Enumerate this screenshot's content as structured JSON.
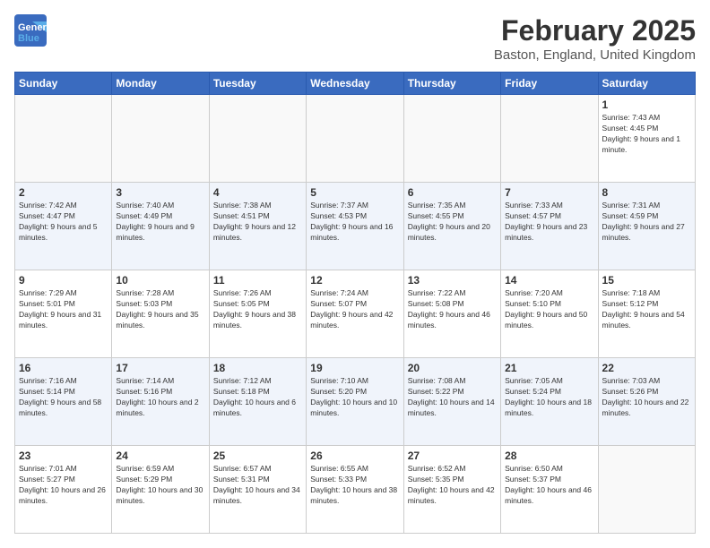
{
  "header": {
    "logo_line1": "General",
    "logo_line2": "Blue",
    "title": "February 2025",
    "location": "Baston, England, United Kingdom"
  },
  "weekdays": [
    "Sunday",
    "Monday",
    "Tuesday",
    "Wednesday",
    "Thursday",
    "Friday",
    "Saturday"
  ],
  "weeks": [
    [
      {
        "day": "",
        "info": ""
      },
      {
        "day": "",
        "info": ""
      },
      {
        "day": "",
        "info": ""
      },
      {
        "day": "",
        "info": ""
      },
      {
        "day": "",
        "info": ""
      },
      {
        "day": "",
        "info": ""
      },
      {
        "day": "1",
        "info": "Sunrise: 7:43 AM\nSunset: 4:45 PM\nDaylight: 9 hours and 1 minute."
      }
    ],
    [
      {
        "day": "2",
        "info": "Sunrise: 7:42 AM\nSunset: 4:47 PM\nDaylight: 9 hours and 5 minutes."
      },
      {
        "day": "3",
        "info": "Sunrise: 7:40 AM\nSunset: 4:49 PM\nDaylight: 9 hours and 9 minutes."
      },
      {
        "day": "4",
        "info": "Sunrise: 7:38 AM\nSunset: 4:51 PM\nDaylight: 9 hours and 12 minutes."
      },
      {
        "day": "5",
        "info": "Sunrise: 7:37 AM\nSunset: 4:53 PM\nDaylight: 9 hours and 16 minutes."
      },
      {
        "day": "6",
        "info": "Sunrise: 7:35 AM\nSunset: 4:55 PM\nDaylight: 9 hours and 20 minutes."
      },
      {
        "day": "7",
        "info": "Sunrise: 7:33 AM\nSunset: 4:57 PM\nDaylight: 9 hours and 23 minutes."
      },
      {
        "day": "8",
        "info": "Sunrise: 7:31 AM\nSunset: 4:59 PM\nDaylight: 9 hours and 27 minutes."
      }
    ],
    [
      {
        "day": "9",
        "info": "Sunrise: 7:29 AM\nSunset: 5:01 PM\nDaylight: 9 hours and 31 minutes."
      },
      {
        "day": "10",
        "info": "Sunrise: 7:28 AM\nSunset: 5:03 PM\nDaylight: 9 hours and 35 minutes."
      },
      {
        "day": "11",
        "info": "Sunrise: 7:26 AM\nSunset: 5:05 PM\nDaylight: 9 hours and 38 minutes."
      },
      {
        "day": "12",
        "info": "Sunrise: 7:24 AM\nSunset: 5:07 PM\nDaylight: 9 hours and 42 minutes."
      },
      {
        "day": "13",
        "info": "Sunrise: 7:22 AM\nSunset: 5:08 PM\nDaylight: 9 hours and 46 minutes."
      },
      {
        "day": "14",
        "info": "Sunrise: 7:20 AM\nSunset: 5:10 PM\nDaylight: 9 hours and 50 minutes."
      },
      {
        "day": "15",
        "info": "Sunrise: 7:18 AM\nSunset: 5:12 PM\nDaylight: 9 hours and 54 minutes."
      }
    ],
    [
      {
        "day": "16",
        "info": "Sunrise: 7:16 AM\nSunset: 5:14 PM\nDaylight: 9 hours and 58 minutes."
      },
      {
        "day": "17",
        "info": "Sunrise: 7:14 AM\nSunset: 5:16 PM\nDaylight: 10 hours and 2 minutes."
      },
      {
        "day": "18",
        "info": "Sunrise: 7:12 AM\nSunset: 5:18 PM\nDaylight: 10 hours and 6 minutes."
      },
      {
        "day": "19",
        "info": "Sunrise: 7:10 AM\nSunset: 5:20 PM\nDaylight: 10 hours and 10 minutes."
      },
      {
        "day": "20",
        "info": "Sunrise: 7:08 AM\nSunset: 5:22 PM\nDaylight: 10 hours and 14 minutes."
      },
      {
        "day": "21",
        "info": "Sunrise: 7:05 AM\nSunset: 5:24 PM\nDaylight: 10 hours and 18 minutes."
      },
      {
        "day": "22",
        "info": "Sunrise: 7:03 AM\nSunset: 5:26 PM\nDaylight: 10 hours and 22 minutes."
      }
    ],
    [
      {
        "day": "23",
        "info": "Sunrise: 7:01 AM\nSunset: 5:27 PM\nDaylight: 10 hours and 26 minutes."
      },
      {
        "day": "24",
        "info": "Sunrise: 6:59 AM\nSunset: 5:29 PM\nDaylight: 10 hours and 30 minutes."
      },
      {
        "day": "25",
        "info": "Sunrise: 6:57 AM\nSunset: 5:31 PM\nDaylight: 10 hours and 34 minutes."
      },
      {
        "day": "26",
        "info": "Sunrise: 6:55 AM\nSunset: 5:33 PM\nDaylight: 10 hours and 38 minutes."
      },
      {
        "day": "27",
        "info": "Sunrise: 6:52 AM\nSunset: 5:35 PM\nDaylight: 10 hours and 42 minutes."
      },
      {
        "day": "28",
        "info": "Sunrise: 6:50 AM\nSunset: 5:37 PM\nDaylight: 10 hours and 46 minutes."
      },
      {
        "day": "",
        "info": ""
      }
    ]
  ]
}
